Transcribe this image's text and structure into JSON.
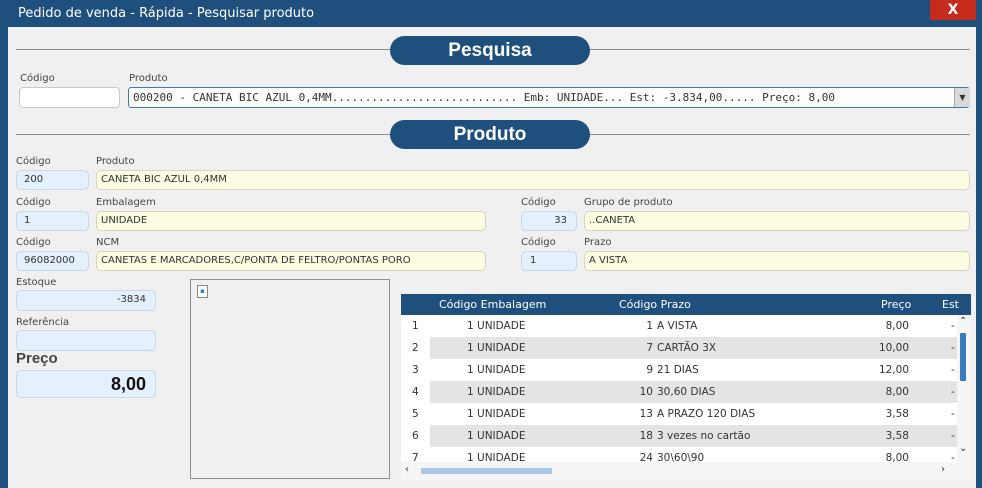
{
  "window": {
    "title": "Pedido de venda - Rápida - Pesquisar produto",
    "close": "X"
  },
  "search_section": {
    "title": "Pesquisa",
    "codigo_label": "Código",
    "codigo_value": "",
    "produto_label": "Produto",
    "produto_value": "000200 - CANETA BIC AZUL 0,4MM............................ Emb: UNIDADE... Est: -3.834,00..... Preço: 8,00"
  },
  "product_section": {
    "title": "Produto",
    "codigo_label": "Código",
    "codigo": "200",
    "produto_label": "Produto",
    "produto": "CANETA BIC AZUL 0,4MM",
    "emb_codigo_label": "Código",
    "emb_codigo": "1",
    "embalagem_label": "Embalagem",
    "embalagem": "UNIDADE",
    "grupo_codigo_label": "Código",
    "grupo_codigo": "33",
    "grupo_label": "Grupo de produto",
    "grupo": "..CANETA",
    "ncm_codigo_label": "Código",
    "ncm_codigo": "96082000",
    "ncm_label": "NCM",
    "ncm": "CANETAS E MARCADORES,C/PONTA DE FELTRO/PONTAS PORO",
    "prazo_codigo_label": "Código",
    "prazo_codigo": "1",
    "prazo_label": "Prazo",
    "prazo": "A VISTA",
    "estoque_label": "Estoque",
    "estoque": "-3834",
    "referencia_label": "Referência",
    "referencia": "",
    "preco_label": "Preço",
    "preco": "8,00"
  },
  "grid": {
    "headers": [
      "Código Embalagem",
      "Código Prazo",
      "Preço",
      "Est"
    ],
    "rows": [
      {
        "n": "1",
        "emb": "1 UNIDADE",
        "prazo_cod": "1",
        "prazo": "A VISTA",
        "preco": "8,00",
        "est": "-"
      },
      {
        "n": "2",
        "emb": "1 UNIDADE",
        "prazo_cod": "7",
        "prazo": "CARTÃO 3X",
        "preco": "10,00",
        "est": "-"
      },
      {
        "n": "3",
        "emb": "1 UNIDADE",
        "prazo_cod": "9",
        "prazo": "21 DIAS",
        "preco": "12,00",
        "est": "-"
      },
      {
        "n": "4",
        "emb": "1 UNIDADE",
        "prazo_cod": "10",
        "prazo": "30,60 DIAS",
        "preco": "8,00",
        "est": "-"
      },
      {
        "n": "5",
        "emb": "1 UNIDADE",
        "prazo_cod": "13",
        "prazo": "A PRAZO 120 DIAS",
        "preco": "3,58",
        "est": "-"
      },
      {
        "n": "6",
        "emb": "1 UNIDADE",
        "prazo_cod": "18",
        "prazo": "3 vezes no cartão",
        "preco": "3,58",
        "est": "-"
      },
      {
        "n": "7",
        "emb": "1 UNIDADE",
        "prazo_cod": "24",
        "prazo": "30\\60\\90",
        "preco": "8,00",
        "est": "-"
      }
    ]
  }
}
